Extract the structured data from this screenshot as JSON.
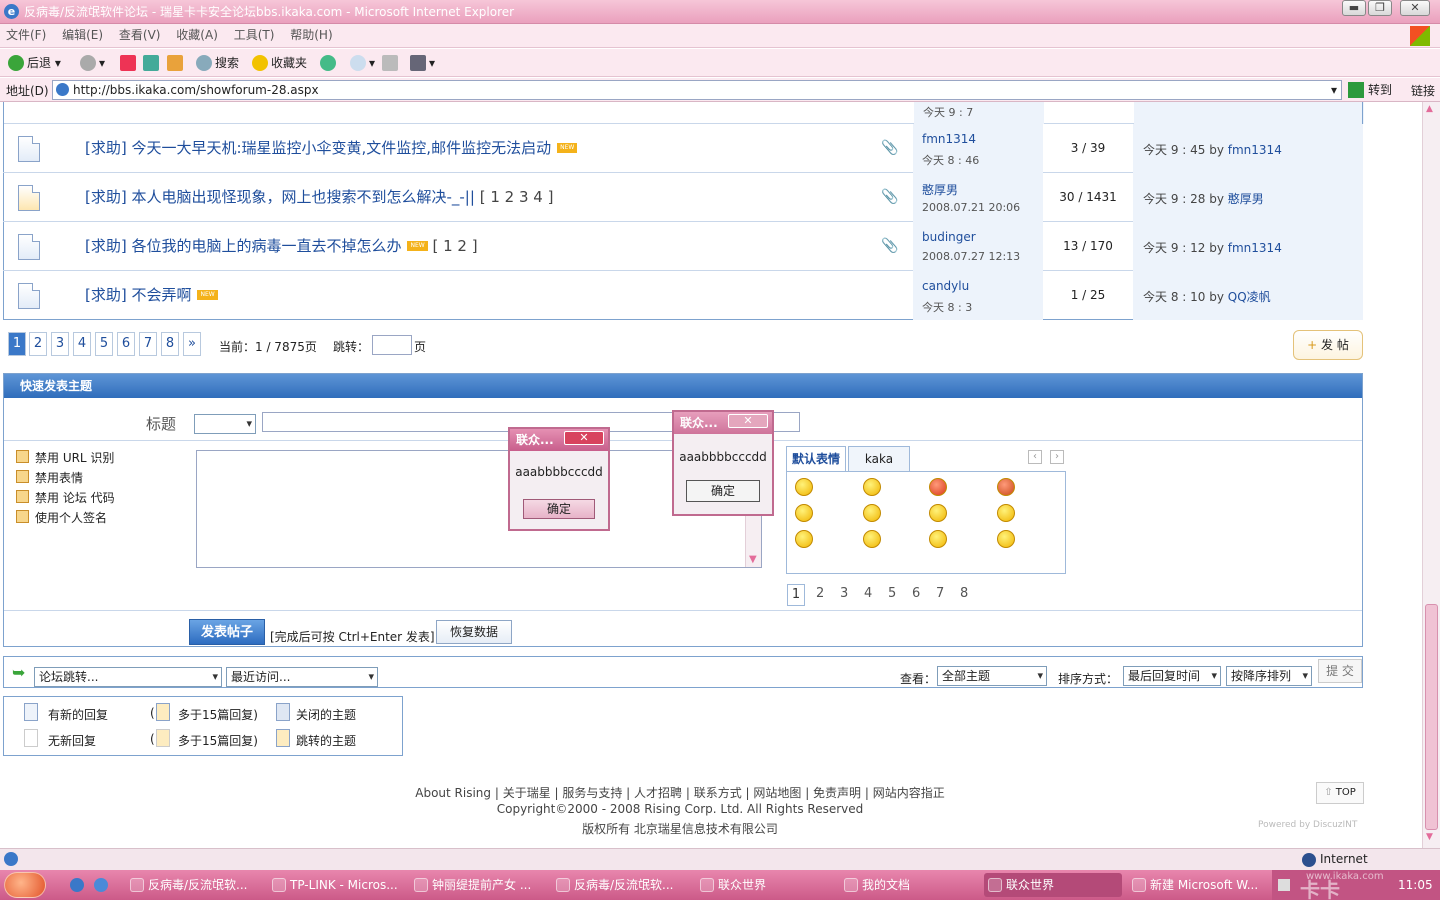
{
  "window": {
    "title": "反病毒/反流氓软件论坛 - 瑞星卡卡安全论坛bbs.ikaka.com - Microsoft Internet Explorer",
    "min": "▬",
    "max": "❐",
    "close": "✕"
  },
  "menu": [
    "文件(F)",
    "编辑(E)",
    "查看(V)",
    "收藏(A)",
    "工具(T)",
    "帮助(H)"
  ],
  "toolbar": {
    "back": "后退",
    "search": "搜索",
    "favorites": "收藏夹"
  },
  "address": {
    "label": "地址(D)",
    "url": "http://bbs.ikaka.com/showforum-28.aspx",
    "go": "转到",
    "links": "链接"
  },
  "threads": [
    {
      "subject": "[求助] 今天一大早天机:瑞星监控小伞变黄,文件监控,邮件监控无法启动",
      "new": "NEW",
      "pages": "",
      "author": "fmn1314",
      "date": "今天 8 : 46",
      "replies": "3 / 39",
      "last_time": "今天 9 : 45 by",
      "last_user": "fmn1314"
    },
    {
      "subject": "[求助] 本人电脑出现怪现象，网上也搜索不到怎么解决-_-||",
      "new": "",
      "pages": "[ 1 2 3 4 ]",
      "author": "憨厚男",
      "date": "2008.07.21 20:06",
      "replies": "30 / 1431",
      "last_time": "今天 9 : 28 by",
      "last_user": "憨厚男"
    },
    {
      "subject": "[求助] 各位我的电脑上的病毒一直去不掉怎么办",
      "new": "NEW",
      "pages": "[ 1 2 ]",
      "author": "budinger",
      "date": "2008.07.27 12:13",
      "replies": "13 / 170",
      "last_time": "今天 9 : 12 by",
      "last_user": "fmn1314"
    },
    {
      "subject": "[求助] 不会弄啊",
      "new": "NEW",
      "pages": "",
      "author": "candylu",
      "date": "今天 8 : 3",
      "replies": "1 / 25",
      "last_time": "今天 8 : 10 by",
      "last_user": "QQ凌帆"
    }
  ],
  "prev_row": {
    "date": "今天 9 : 7"
  },
  "pagination": {
    "pages": [
      "1",
      "2",
      "3",
      "4",
      "5",
      "6",
      "7",
      "8",
      "»"
    ],
    "current_text": "当前：1 / 7875页",
    "jump_label": "跳转：",
    "page_suffix": "页",
    "post_button": "发 帖"
  },
  "quickpost": {
    "header": "快速发表主题",
    "title_label": "标题",
    "options": [
      "禁用 URL 识别",
      "禁用表情",
      "禁用 论坛 代码",
      "使用个人签名"
    ],
    "submit": "发表帖子",
    "hint": "[完成后可按 Ctrl+Enter 发表]",
    "restore": "恢复数据"
  },
  "smilies": {
    "tabs": [
      "默认表情",
      "kaka"
    ],
    "pages": [
      "1",
      "2",
      "3",
      "4",
      "5",
      "6",
      "7",
      "8"
    ]
  },
  "dialogs": [
    {
      "title": "联众...",
      "message": "aaabbbbcccdd",
      "ok": "确定"
    },
    {
      "title": "联众...",
      "message": "aaabbbbcccdd",
      "ok": "确定"
    }
  ],
  "bottom": {
    "forum_jump": "论坛跳转...",
    "recent": "最近访问...",
    "view_label": "查看：",
    "view_value": "全部主题",
    "sort_label": "排序方式：",
    "sort_value": "最后回复时间",
    "order_value": "按降序排列",
    "submit": "提 交"
  },
  "legend": [
    "有新的回复",
    "无新回复",
    "多于15篇回复)",
    "多于15篇回复)",
    "关闭的主题",
    "跳转的主题"
  ],
  "footer": {
    "links": "About Rising | 关于瑞星 | 服务与支持 | 人才招聘 | 联系方式 | 网站地图 | 免责声明 | 网站内容指正",
    "copyright": "Copyright©2000 - 2008 Rising Corp. Ltd.   All Rights Reserved",
    "owner": "版权所有 北京瑞星信息技术有限公司",
    "top": "TOP",
    "powered": "Powered by DiscuzINT"
  },
  "status": {
    "zone": "Internet"
  },
  "taskbar": {
    "items": [
      "反病毒/反流氓软...",
      "TP-LINK - Micros...",
      "钟丽缇提前产女 ...",
      "反病毒/反流氓软...",
      "联众世界",
      "我的文档",
      "联众世界",
      "新建 Microsoft W..."
    ],
    "clock": "11:05",
    "watermark": "卡卡",
    "watermark_url": "www.ikaka.com"
  }
}
